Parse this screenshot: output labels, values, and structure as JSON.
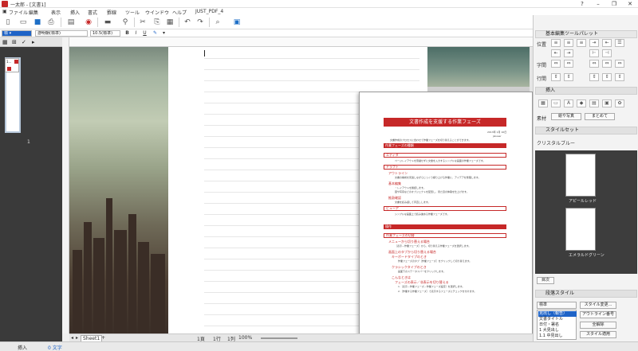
{
  "window": {
    "title": "一太郎 - [文書1]"
  },
  "menu": [
    "ファイル",
    "編集",
    "表示",
    "挿入",
    "書式",
    "罫線",
    "ツール",
    "ウインドウ",
    "ヘルプ",
    "JUST_PDF_4"
  ],
  "toolbar": {
    "mode_label": "文字",
    "icons": [
      "new-doc-icon",
      "open-icon",
      "save-icon",
      "print-icon",
      "send-icon",
      "scanner-icon",
      "cut-icon",
      "copy-icon",
      "paste-icon",
      "undo-icon",
      "redo-icon",
      "find-icon",
      "jump-icon"
    ]
  },
  "format_bar": {
    "font": "游明朝(標準)",
    "size": "10.5(標準)",
    "bold": "B",
    "italic": "I",
    "underline": "U"
  },
  "left_panel": {
    "page_number": "1",
    "popup_label": "1..."
  },
  "preview": {
    "title": "文書作成を支援する作業フェーズ",
    "date": "2013年 1月 10日",
    "author": "jskuser",
    "intro": "文書作成のプロセスに合わせて作業フェーズを切り替えることができます。",
    "section1": "作業フェーズの種類",
    "edit": "エディタ",
    "edit_desc": "ページレイアウトを意識せずに文章を入力するシンプルな画面の作業フェーズです。",
    "draft": "ドラフト",
    "outline": "アウトライン",
    "outline_desc": "文書の構成を見渡しながらじっくり練り上げる作業に、アイデアを整理します。",
    "basic": "基本編集",
    "basic_desc1": "・レイアウトを確認します。",
    "basic_desc2": "図や写真などのオブジェクトを配置し、見た目の体裁を仕上げます。",
    "proof": "推敲確認",
    "proof_desc": "文書を読み返して手直しします。",
    "review": "ビューア",
    "review_desc": "シンプルな画面上で読み進める作業フェーズです。",
    "section2": "操作",
    "switch": "作業フェーズの切替",
    "menu_switch": "メニューから切り替える場合",
    "menu_desc": "［表示－作業フェーズ］から、切り替える作業フェーズを選択します。",
    "tab_switch": "画面上のタブから切り替える場合",
    "tab_desc1": "キーボードタイプのとき",
    "tab_desc2": "作業フェーズのタブ［作業フェーズ］をクリックして切り替えます。",
    "click_desc": "クラシックタイプのとき",
    "click_desc2": "画面下のステータスバーをクリックします。",
    "other": "こんなときは",
    "other_desc": "フェーズの表示／非表示を切り替える",
    "other_desc2": "1.［表示－作業フェーズ－作業フェーズ設定］を選択します。",
    "other_desc3": "2.［作業する作業フェーズ］で表示するフェーズにチェックを付けます。"
  },
  "right_panel": {
    "title": "基本編集ツールパレット",
    "label_position": "位置",
    "label_char": "字間",
    "label_line": "行間",
    "insert_header": "挿入",
    "insert_label": "素材",
    "insert_btn1": "絵や写真",
    "insert_btn2": "まとめて",
    "styleset_header": "スタイルセット",
    "style_selected": "クリスタルブルー",
    "style1": "アピールレッド",
    "style2": "エメラルドグリーン",
    "style_button": "目次",
    "para_header": "段落スタイル",
    "para_standard": "標準",
    "para_list": [
      "見出し（報告）",
      "文書タイトル",
      "日付・署名",
      "1 大見出し",
      "1.1 中見出し",
      "1.1.1 小見出し"
    ],
    "btn_change": "スタイル変更...",
    "btn_outline": "アウトライン番号",
    "btn_register": "全解除",
    "btn_apply": "スタイル適用"
  },
  "status": {
    "insert_mode": "挿入",
    "char_count": "0 文字",
    "sheet_tab": "Sheet1",
    "page": "1頁",
    "line": "1行",
    "zoom": "100%",
    "position": "1列"
  }
}
